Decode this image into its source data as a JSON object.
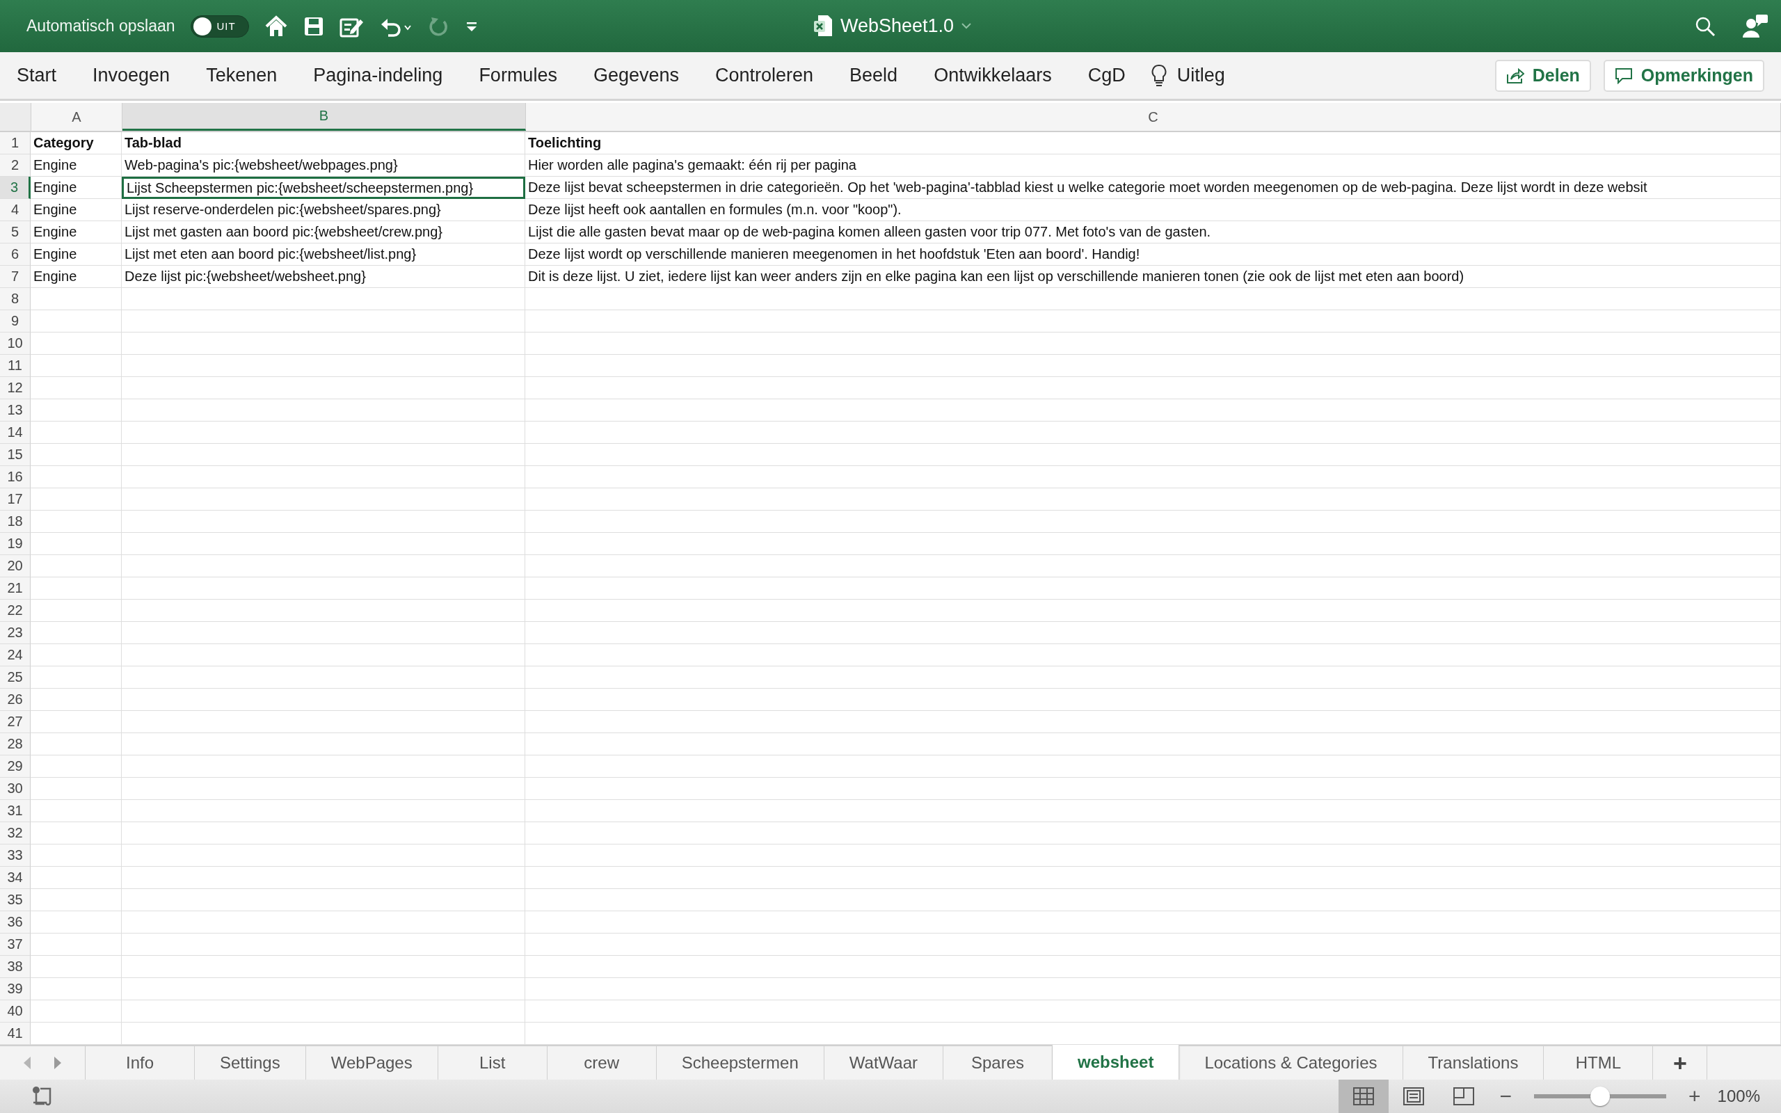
{
  "title_bar": {
    "autosave_label": "Automatisch opslaan",
    "autosave": {
      "on": false,
      "label": "UIT"
    },
    "redo_disabled": true,
    "document_title": "WebSheet1.0"
  },
  "ribbon": {
    "tabs": [
      {
        "label": "Start"
      },
      {
        "label": "Invoegen"
      },
      {
        "label": "Tekenen"
      },
      {
        "label": "Pagina-indeling"
      },
      {
        "label": "Formules"
      },
      {
        "label": "Gegevens"
      },
      {
        "label": "Controleren"
      },
      {
        "label": "Beeld"
      },
      {
        "label": "Ontwikkelaars"
      },
      {
        "label": "CgD"
      }
    ],
    "tell_me": "Uitleg",
    "share_button": "Delen",
    "comments_button": "Opmerkingen"
  },
  "sheet": {
    "columns": [
      {
        "label": "A",
        "selected": false
      },
      {
        "label": "B",
        "selected": true
      },
      {
        "label": "C",
        "selected": false
      }
    ],
    "rows": [
      {
        "number": "1",
        "selected": false,
        "bold": true,
        "cells": [
          {
            "text": "Category",
            "selected": false
          },
          {
            "text": "Tab-blad",
            "selected": false
          },
          {
            "text": "Toelichting",
            "selected": false
          }
        ]
      },
      {
        "number": "2",
        "selected": false,
        "bold": false,
        "cells": [
          {
            "text": "Engine",
            "selected": false
          },
          {
            "text": "Web-pagina's pic:{websheet/webpages.png}",
            "selected": false
          },
          {
            "text": "Hier worden alle pagina's gemaakt: één rij per pagina",
            "selected": false
          }
        ]
      },
      {
        "number": "3",
        "selected": true,
        "bold": false,
        "cells": [
          {
            "text": "Engine",
            "selected": false
          },
          {
            "text": "Lijst Scheepstermen pic:{websheet/scheepstermen.png}",
            "selected": true
          },
          {
            "text": "Deze lijst bevat scheepstermen in drie categorieën. Op het 'web-pagina'-tabblad kiest u welke categorie moet worden meegenomen op de web-pagina. Deze lijst wordt in deze websit",
            "selected": false
          }
        ]
      },
      {
        "number": "4",
        "selected": false,
        "bold": false,
        "cells": [
          {
            "text": "Engine",
            "selected": false
          },
          {
            "text": "Lijst reserve-onderdelen pic:{websheet/spares.png}",
            "selected": false
          },
          {
            "text": "Deze lijst heeft ook aantallen en formules (m.n. voor \"koop\").",
            "selected": false
          }
        ]
      },
      {
        "number": "5",
        "selected": false,
        "bold": false,
        "cells": [
          {
            "text": "Engine",
            "selected": false
          },
          {
            "text": "Lijst met gasten aan boord pic:{websheet/crew.png}",
            "selected": false
          },
          {
            "text": "Lijst die alle gasten bevat maar op de web-pagina komen alleen gasten voor trip 077. Met foto's van de gasten.",
            "selected": false
          }
        ]
      },
      {
        "number": "6",
        "selected": false,
        "bold": false,
        "cells": [
          {
            "text": "Engine",
            "selected": false
          },
          {
            "text": "Lijst met eten aan boord pic:{websheet/list.png}",
            "selected": false
          },
          {
            "text": "Deze lijst wordt op verschillende manieren meegenomen in het hoofdstuk 'Eten aan boord'. Handig!",
            "selected": false
          }
        ]
      },
      {
        "number": "7",
        "selected": false,
        "bold": false,
        "cells": [
          {
            "text": "Engine",
            "selected": false
          },
          {
            "text": "Deze lijst pic:{websheet/websheet.png}",
            "selected": false
          },
          {
            "text": "Dit is deze lijst. U ziet, iedere lijst kan weer anders zijn en elke pagina kan een lijst op verschillende manieren tonen (zie ook de lijst met eten aan boord)",
            "selected": false
          }
        ]
      },
      {
        "number": "8",
        "selected": false
      },
      {
        "number": "9",
        "selected": false
      },
      {
        "number": "10",
        "selected": false
      },
      {
        "number": "11",
        "selected": false
      },
      {
        "number": "12",
        "selected": false
      },
      {
        "number": "13",
        "selected": false
      },
      {
        "number": "14",
        "selected": false
      },
      {
        "number": "15",
        "selected": false
      },
      {
        "number": "16",
        "selected": false
      },
      {
        "number": "17",
        "selected": false
      },
      {
        "number": "18",
        "selected": false
      },
      {
        "number": "19",
        "selected": false
      },
      {
        "number": "20",
        "selected": false
      },
      {
        "number": "21",
        "selected": false
      },
      {
        "number": "22",
        "selected": false
      },
      {
        "number": "23",
        "selected": false
      },
      {
        "number": "24",
        "selected": false
      },
      {
        "number": "25",
        "selected": false
      },
      {
        "number": "26",
        "selected": false
      },
      {
        "number": "27",
        "selected": false
      },
      {
        "number": "28",
        "selected": false
      },
      {
        "number": "29",
        "selected": false
      },
      {
        "number": "30",
        "selected": false
      },
      {
        "number": "31",
        "selected": false
      },
      {
        "number": "32",
        "selected": false
      },
      {
        "number": "33",
        "selected": false
      },
      {
        "number": "34",
        "selected": false
      },
      {
        "number": "35",
        "selected": false
      },
      {
        "number": "36",
        "selected": false
      },
      {
        "number": "37",
        "selected": false
      },
      {
        "number": "38",
        "selected": false
      },
      {
        "number": "39",
        "selected": false
      },
      {
        "number": "40",
        "selected": false
      },
      {
        "number": "41",
        "selected": false
      }
    ]
  },
  "sheet_tabs": [
    {
      "label": "Info",
      "selected": false
    },
    {
      "label": "Settings",
      "selected": false
    },
    {
      "label": "WebPages",
      "selected": false
    },
    {
      "label": "List",
      "selected": false
    },
    {
      "label": "crew",
      "selected": false
    },
    {
      "label": "Scheepstermen",
      "selected": false
    },
    {
      "label": "WatWaar",
      "selected": false
    },
    {
      "label": "Spares",
      "selected": false
    },
    {
      "label": "websheet",
      "selected": true
    },
    {
      "label": "Locations & Categories",
      "selected": false
    },
    {
      "label": "Translations",
      "selected": false
    },
    {
      "label": "HTML",
      "selected": false
    }
  ],
  "add_sheet": "+",
  "status_bar": {
    "views": [
      {
        "kind": "normal",
        "selected": true
      },
      {
        "kind": "layout",
        "selected": false
      },
      {
        "kind": "pagebreak",
        "selected": false
      }
    ],
    "zoom_out": "−",
    "zoom_in": "+",
    "zoom": {
      "level": 0.5
    },
    "zoom_label": "100%"
  }
}
